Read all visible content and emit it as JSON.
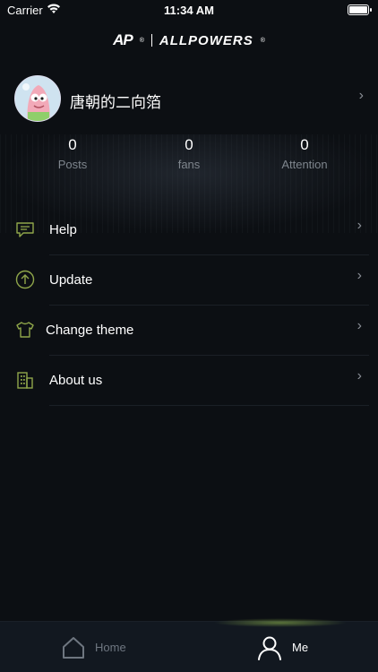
{
  "status": {
    "carrier": "Carrier",
    "time": "11:34 AM"
  },
  "brand": {
    "mark": "AP",
    "name": "ALLPOWERS",
    "reg": "®"
  },
  "profile": {
    "username": "唐朝的二向箔"
  },
  "stats": [
    {
      "value": "0",
      "label": "Posts"
    },
    {
      "value": "0",
      "label": "fans"
    },
    {
      "value": "0",
      "label": "Attention"
    }
  ],
  "menu": [
    {
      "label": "Help",
      "icon": "chat-icon"
    },
    {
      "label": "Update",
      "icon": "upload-arrow-icon"
    },
    {
      "label": "Change theme",
      "icon": "shirt-icon"
    },
    {
      "label": "About us",
      "icon": "building-icon"
    }
  ],
  "tabs": [
    {
      "label": "Home",
      "icon": "home-icon",
      "active": false
    },
    {
      "label": "Me",
      "icon": "person-icon",
      "active": true
    }
  ],
  "colors": {
    "background": "#0c0f13",
    "accent": "#8fa64a",
    "inactive_tab": "#6e7680",
    "secondary_text": "#7e858d"
  }
}
